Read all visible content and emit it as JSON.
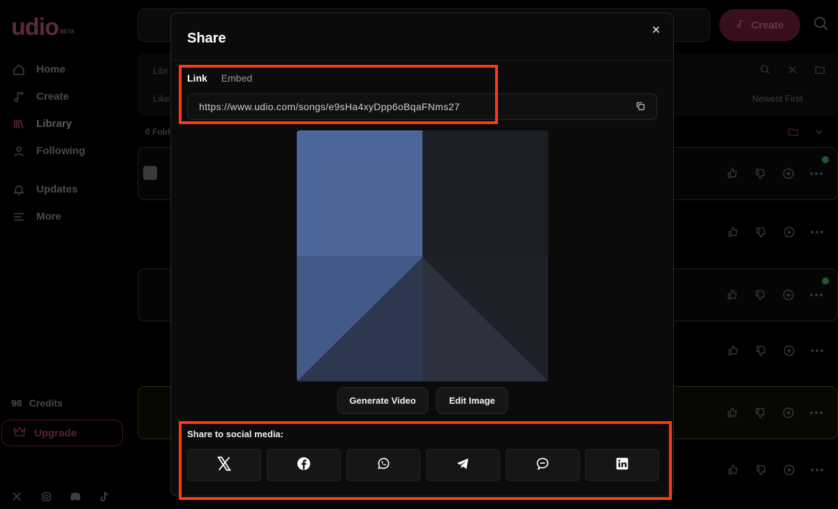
{
  "app": {
    "logo_text": "udio",
    "logo_badge": "BETA"
  },
  "sidebar": {
    "items": [
      {
        "label": "Home",
        "icon": "home-icon"
      },
      {
        "label": "Create",
        "icon": "music-note-icon"
      },
      {
        "label": "Library",
        "icon": "library-icon",
        "active": true
      },
      {
        "label": "Following",
        "icon": "user-icon"
      },
      {
        "label": "Updates",
        "icon": "bell-icon"
      },
      {
        "label": "More",
        "icon": "menu-icon"
      }
    ],
    "credits_count": "98",
    "credits_label": "Credits",
    "upgrade_label": "Upgrade",
    "socials": [
      "x-icon",
      "instagram-icon",
      "discord-icon",
      "tiktok-icon"
    ]
  },
  "header": {
    "create_label": "Create"
  },
  "library": {
    "tab_label_partial": "Libr",
    "filter_partial": "Like",
    "sort_label": "Newest First",
    "folders_partial": "0 Fold"
  },
  "modal": {
    "title": "Share",
    "tabs": [
      {
        "label": "Link",
        "active": true
      },
      {
        "label": "Embed",
        "active": false
      }
    ],
    "link_url": "https://www.udio.com/songs/e9sHa4xyDpp6oBqaFNms27",
    "buttons": {
      "generate_video": "Generate Video",
      "edit_image": "Edit Image"
    },
    "social_label": "Share to social media:",
    "social_buttons": [
      "x-icon",
      "facebook-icon",
      "whatsapp-icon",
      "telegram-icon",
      "message-icon",
      "linkedin-icon"
    ]
  },
  "colors": {
    "accent_highlight": "#ff3b12",
    "cover_blue": "#4d679b",
    "cover_dark": "#1b1e24"
  }
}
